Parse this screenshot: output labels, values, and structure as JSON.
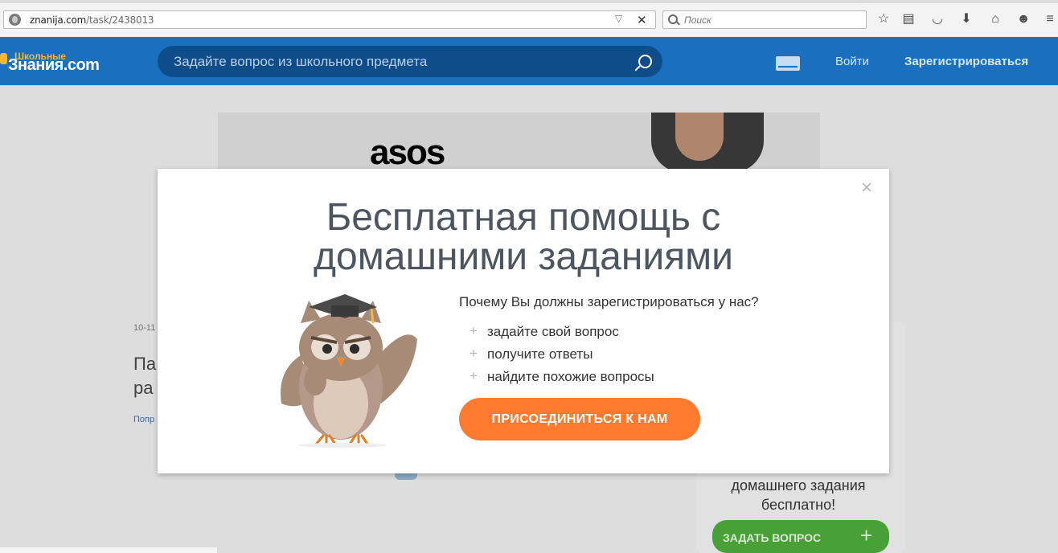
{
  "browser": {
    "url_domain": "znanija.com",
    "url_path": "/task/2438013",
    "search_placeholder": "Поиск"
  },
  "header": {
    "logo_small": "Школьные",
    "logo_main": "Знания.com",
    "search_placeholder": "Задайте вопрос из школьного предмета",
    "login": "Войти",
    "register": "Зарегистрироваться"
  },
  "background": {
    "ad_brand": "asos",
    "crumb": "10-11",
    "title_line1": "Па",
    "title_line2": "ра",
    "link": "Попр",
    "side_text_line1": "домашнего задания",
    "side_text_line2": "бесплатно!",
    "ask_button": "ЗАДАТЬ ВОПРОС"
  },
  "modal": {
    "close": "×",
    "title_line1": "Бесплатная помощь с",
    "title_line2": "домашними заданиями",
    "why": "Почему Вы должны зарегистрироваться у нас?",
    "benefits": [
      "задайте свой вопрос",
      "получите ответы",
      "найдите похожие вопросы"
    ],
    "join_button": "ПРИСОЕДИНИТЬСЯ К НАМ"
  },
  "colors": {
    "header_bg": "#1a70be",
    "join_button": "#fd7a2f",
    "ask_button": "#4ca73a",
    "title_text": "#4c5560"
  }
}
